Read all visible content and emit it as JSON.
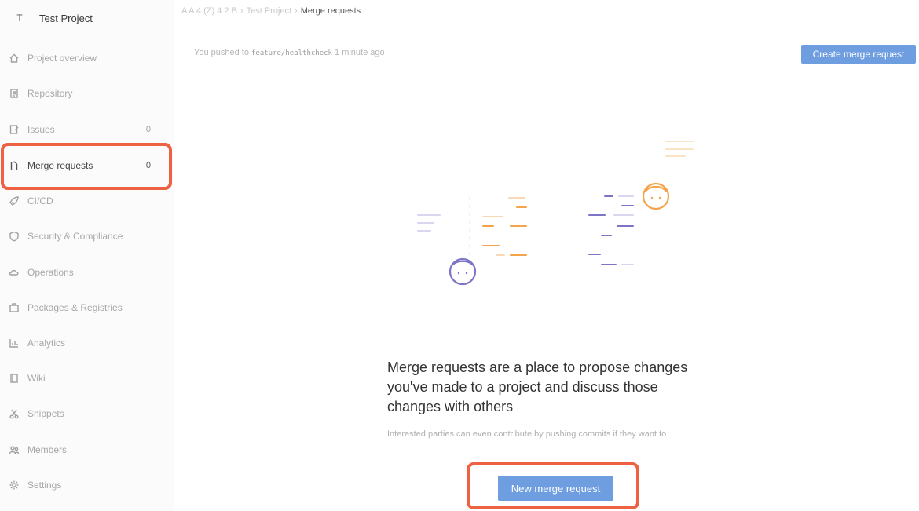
{
  "project": {
    "avatar_letter": "T",
    "name": "Test Project"
  },
  "breadcrumb": {
    "parent": "A A 4 (Z) 4 2 B",
    "project": "Test Project",
    "current": "Merge requests"
  },
  "sidebar": {
    "items": [
      {
        "label": "Project overview",
        "icon": "home-icon"
      },
      {
        "label": "Repository",
        "icon": "doc-icon"
      },
      {
        "label": "Issues",
        "icon": "issues-icon",
        "count": "0"
      },
      {
        "label": "Merge requests",
        "icon": "merge-request-icon",
        "count": "0",
        "active": true
      },
      {
        "label": "CI/CD",
        "icon": "rocket-icon"
      },
      {
        "label": "Security & Compliance",
        "icon": "shield-icon"
      },
      {
        "label": "Operations",
        "icon": "cloud-icon"
      },
      {
        "label": "Packages & Registries",
        "icon": "package-icon"
      },
      {
        "label": "Analytics",
        "icon": "chart-icon"
      },
      {
        "label": "Wiki",
        "icon": "book-icon"
      },
      {
        "label": "Snippets",
        "icon": "scissors-icon"
      },
      {
        "label": "Members",
        "icon": "users-icon"
      },
      {
        "label": "Settings",
        "icon": "gear-icon"
      }
    ]
  },
  "push_notice": {
    "prefix": "You pushed to",
    "branch": "feature/healthcheck",
    "suffix": "1 minute ago"
  },
  "buttons": {
    "create_mr": "Create merge request",
    "new_mr": "New merge request"
  },
  "empty_state": {
    "title": "Merge requests are a place to propose changes you've made to a project and discuss those changes with others",
    "subtitle": "Interested parties can even contribute by pushing commits if they want to"
  },
  "colors": {
    "accent": "#6f9ee0",
    "highlight": "#ee6244",
    "illustration_orange": "#f5a44a",
    "illustration_purple": "#7b74c7"
  }
}
